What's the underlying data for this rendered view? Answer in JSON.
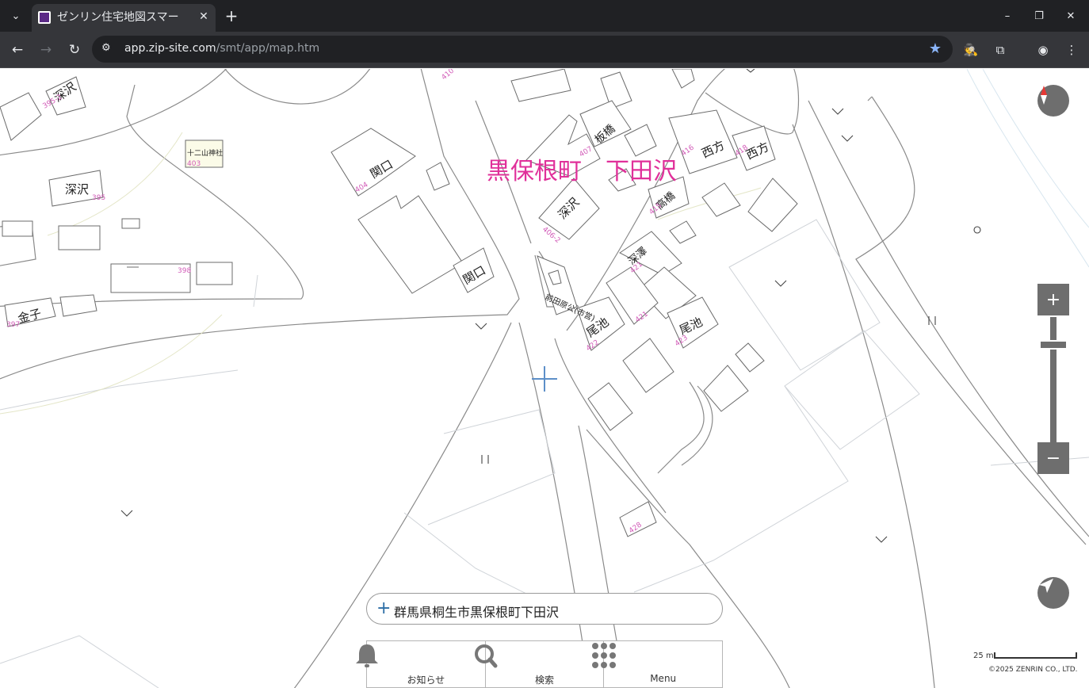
{
  "browser": {
    "tab_list_icon": "chevron-down-icon",
    "tab_title": "ゼンリン住宅地図スマー",
    "url_host": "app.zip-site.com",
    "url_path": "/smt/app/map.htm"
  },
  "map": {
    "area_label": "黒保根町　下田沢",
    "buildings": [
      {
        "name": "深沢",
        "number": "395-2"
      },
      {
        "name": "十二山神社",
        "number": "403"
      },
      {
        "name": "関口",
        "number": "404"
      },
      {
        "name": "深沢",
        "number": "395"
      },
      {
        "name": "398",
        "number": ""
      },
      {
        "name": "金子",
        "number": "397"
      },
      {
        "name": "関口",
        "number": ""
      },
      {
        "name": "板橋",
        "number": "407"
      },
      {
        "name": "深沢",
        "number": "406-2"
      },
      {
        "name": "西方",
        "number": "416"
      },
      {
        "name": "西方",
        "number": "418"
      },
      {
        "name": "高橋",
        "number": "415"
      },
      {
        "name": "深澤",
        "number": "421"
      },
      {
        "name": "前田原公(市営)",
        "number": ""
      },
      {
        "name": "尾池",
        "number": "422"
      },
      {
        "name": "尾池",
        "number": "423"
      },
      {
        "name": "421",
        "number": ""
      },
      {
        "name": "410",
        "number": ""
      },
      {
        "name": "428",
        "number": ""
      }
    ],
    "scale_label": "25 m",
    "copyright": "©2025 ZENRIN CO., LTD."
  },
  "search": {
    "address": "群馬県桐生市黒保根町下田沢"
  },
  "bottom_nav": {
    "notice_label": "お知らせ",
    "search_label": "検索",
    "menu_label": "Menu"
  },
  "colors": {
    "accent_pink": "#e0309a",
    "control_gray": "#6e6e6e",
    "chrome_dark": "#202124"
  }
}
